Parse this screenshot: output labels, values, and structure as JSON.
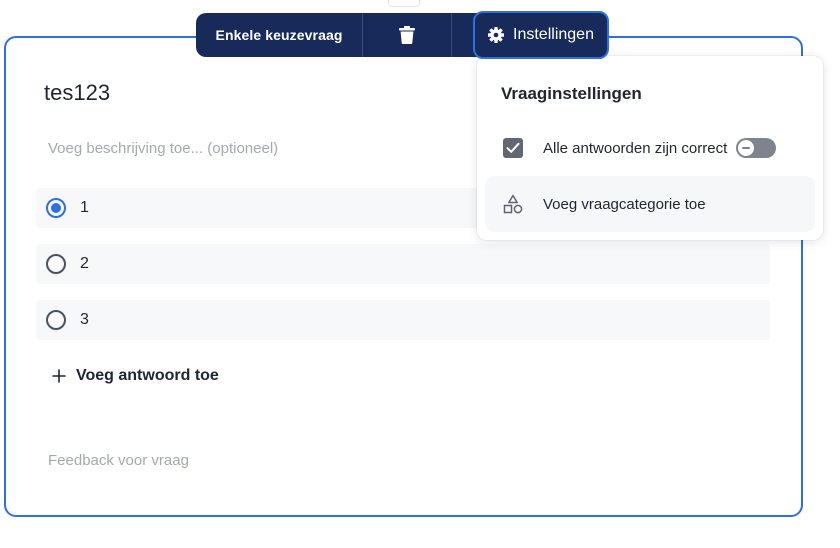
{
  "toolbar": {
    "question_type": "Enkele keuzevraag",
    "delete_icon": "trash-icon",
    "settings_icon": "gear-icon",
    "settings_label": "Instellingen"
  },
  "question": {
    "title": "tes123",
    "description_placeholder": "Voeg beschrijving toe... (optioneel)",
    "answers": [
      {
        "label": "1",
        "selected": true
      },
      {
        "label": "2",
        "selected": false
      },
      {
        "label": "3",
        "selected": false
      }
    ],
    "add_answer_label": "Voeg antwoord toe",
    "feedback_placeholder": "Feedback voor vraag"
  },
  "settings_panel": {
    "title": "Vraaginstellingen",
    "all_correct_label": "Alle antwoorden zijn correct",
    "all_correct_checked": true,
    "all_correct_toggle_on": false,
    "add_category_label": "Voeg vraagcategorie toe",
    "add_category_icon": "shapes-icon"
  },
  "colors": {
    "toolbar_bg": "#172a5a",
    "accent": "#2f6fe0",
    "placeholder": "#a3a8b3",
    "answer_bg": "#f7f8fa"
  }
}
